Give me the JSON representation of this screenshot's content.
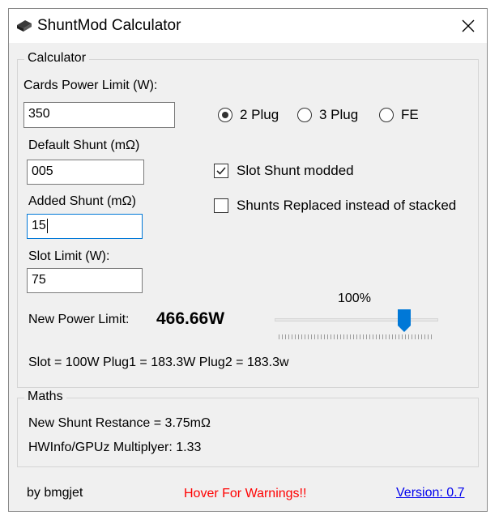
{
  "window": {
    "title": "ShuntMod Calculator",
    "icon": "app-icon",
    "close_symbol": "✕"
  },
  "calculator": {
    "group_label": "Calculator",
    "cards_power_label": "Cards Power Limit (W):",
    "cards_power_value": "350",
    "default_shunt_label": "Default Shunt (mΩ)",
    "default_shunt_value": "005",
    "added_shunt_label": "Added Shunt (mΩ)",
    "added_shunt_value": "15",
    "slot_limit_label": "Slot Limit (W):",
    "slot_limit_value": "75",
    "plug_options": [
      {
        "label": "2 Plug",
        "selected": true
      },
      {
        "label": "3 Plug",
        "selected": false
      },
      {
        "label": "FE",
        "selected": false
      }
    ],
    "slot_shunt_modded_label": "Slot Shunt modded",
    "slot_shunt_modded_checked": true,
    "shunts_replaced_label": "Shunts Replaced instead of stacked",
    "shunts_replaced_checked": false,
    "new_power_label": "New Power Limit:",
    "new_power_value": "466.66W",
    "slider_percent_label": "100%",
    "slider_fraction": 0.82,
    "summary": "Slot = 100W Plug1 = 183.3W Plug2 = 183.3w"
  },
  "maths": {
    "group_label": "Maths",
    "shunt_resistance": "New Shunt Restance = 3.75mΩ",
    "multiplier": "HWInfo/GPUz Multiplyer: 1.33"
  },
  "footer": {
    "author": "by bmgjet",
    "warnings": "Hover For Warnings!!",
    "version": "Version:  0.7"
  },
  "colors": {
    "accent": "#0078d7",
    "warning": "#ff0000",
    "link": "#0000ee"
  }
}
